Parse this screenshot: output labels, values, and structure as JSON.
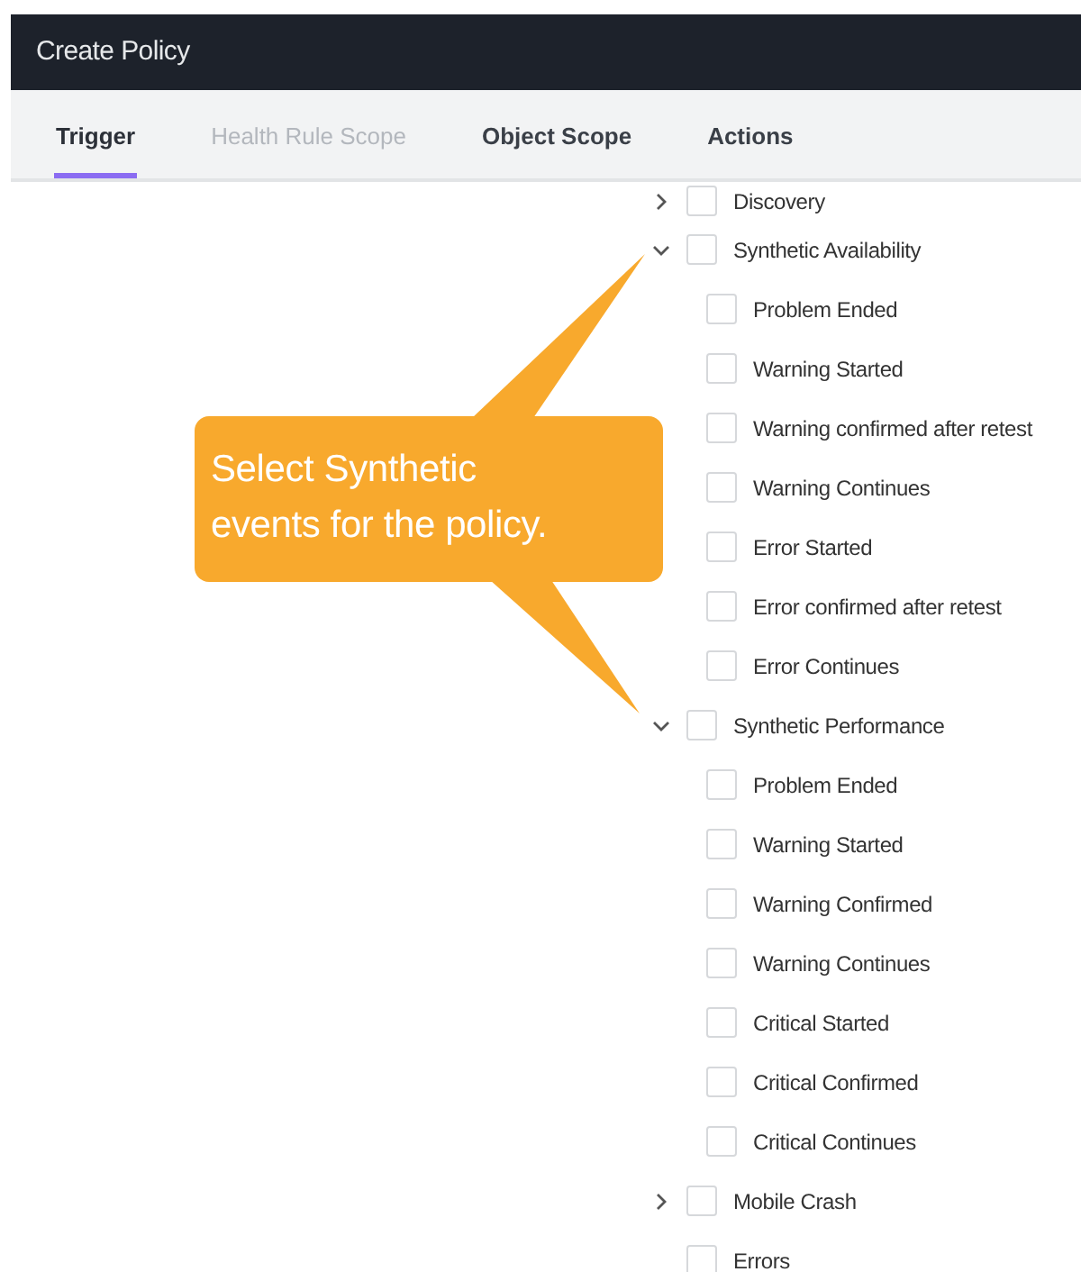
{
  "window": {
    "title": "Create Policy"
  },
  "tabs": [
    {
      "label": "Trigger",
      "selected": true,
      "disabled": false
    },
    {
      "label": "Health Rule Scope",
      "selected": false,
      "disabled": true
    },
    {
      "label": "Object Scope",
      "selected": false,
      "disabled": false
    },
    {
      "label": "Actions",
      "selected": false,
      "disabled": false
    }
  ],
  "event_tree": [
    {
      "label": "Discovery",
      "checked": false,
      "expanded": false
    },
    {
      "label": "Synthetic Availability",
      "checked": false,
      "expanded": true,
      "children": [
        {
          "label": "Problem Ended",
          "checked": false
        },
        {
          "label": "Warning Started",
          "checked": false
        },
        {
          "label": "Warning confirmed after retest",
          "checked": false
        },
        {
          "label": "Warning Continues",
          "checked": false
        },
        {
          "label": "Error Started",
          "checked": false
        },
        {
          "label": "Error confirmed after retest",
          "checked": false
        },
        {
          "label": "Error Continues",
          "checked": false
        }
      ]
    },
    {
      "label": "Synthetic Performance",
      "checked": false,
      "expanded": true,
      "children": [
        {
          "label": "Problem Ended",
          "checked": false
        },
        {
          "label": "Warning Started",
          "checked": false
        },
        {
          "label": "Warning Confirmed",
          "checked": false
        },
        {
          "label": "Warning Continues",
          "checked": false
        },
        {
          "label": "Critical Started",
          "checked": false
        },
        {
          "label": "Critical Confirmed",
          "checked": false
        },
        {
          "label": "Critical Continues",
          "checked": false
        }
      ]
    },
    {
      "label": "Mobile Crash",
      "checked": false,
      "expanded": false
    },
    {
      "label": "Errors",
      "checked": false
    }
  ],
  "callout": {
    "text": "Select Synthetic events for the policy."
  }
}
